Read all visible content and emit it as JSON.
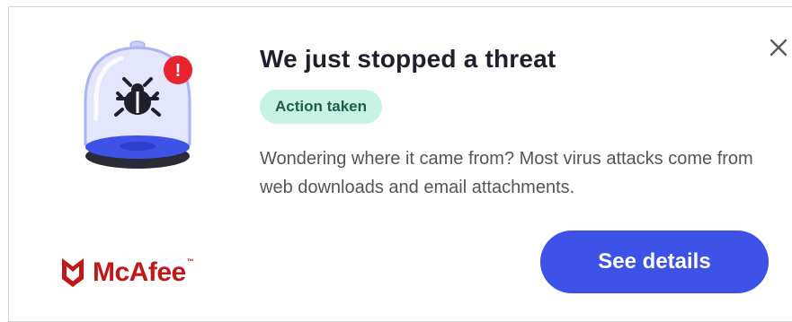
{
  "notification": {
    "title": "We just stopped a threat",
    "badge": "Action taken",
    "description": "Wondering where it came from? Most virus attacks come from web downloads and email attachments.",
    "primary_button": "See details",
    "brand": {
      "name": "McAfee",
      "trademark": "™"
    },
    "alert_mark": "!"
  },
  "icons": {
    "close": "close-icon",
    "illustration": "quarantined-bug-illustration",
    "logo": "mcafee-shield-logo"
  },
  "colors": {
    "primary_button": "#3d52e6",
    "badge_background": "#c6f3e3",
    "badge_text": "#1e5c4c",
    "brand_red": "#c01818",
    "alert_red": "#e8252e",
    "dome_blue": "#b9c2f8",
    "platform_blue": "#3d52e6"
  }
}
